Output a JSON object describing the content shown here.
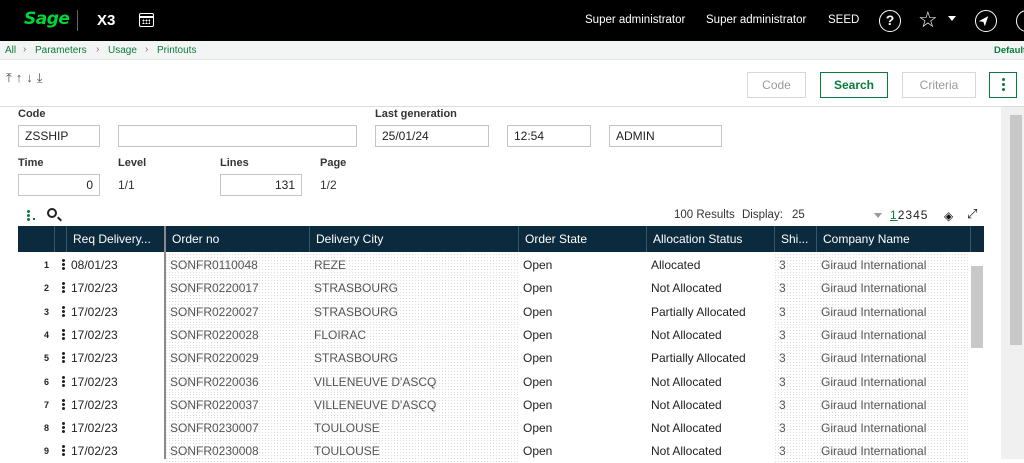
{
  "topbar": {
    "logo": "Sage",
    "app": "X3",
    "user1": "Super administrator",
    "user2": "Super administrator",
    "folder": "SEED",
    "help_icon": "help-icon",
    "favorites_icon": "star-icon",
    "navigate_icon": "compass-icon"
  },
  "breadcrumb": {
    "items": [
      "All",
      "Parameters",
      "Usage",
      "Printouts"
    ],
    "default_label": "Default"
  },
  "actions": {
    "code": "Code",
    "search": "Search",
    "criteria": "Criteria"
  },
  "form": {
    "code_label": "Code",
    "code_value": "ZSSHIP",
    "description_value": "",
    "last_gen_label": "Last generation",
    "last_gen_date": "25/01/24",
    "last_gen_time": "12:54",
    "last_gen_user": "ADMIN",
    "time_label": "Time",
    "time_value": "0",
    "level_label": "Level",
    "level_value": "1/1",
    "lines_label": "Lines",
    "lines_value": "131",
    "page_label": "Page",
    "page_value": "1/2"
  },
  "grid": {
    "results": "100 Results",
    "display_label": "Display:",
    "display_value": "25",
    "pages": [
      "1",
      "2",
      "3",
      "4",
      "5"
    ],
    "columns": [
      "Req Delivery...",
      "Order no",
      "Delivery City",
      "Order State",
      "Allocation Status",
      "Shi...",
      "Company Name"
    ],
    "rows": [
      {
        "n": "1",
        "date": "08/01/23",
        "order": "SONFR0110048",
        "city": "REZE",
        "state": "Open",
        "alloc": "Allocated",
        "ship": "3",
        "company": "Giraud International"
      },
      {
        "n": "2",
        "date": "17/02/23",
        "order": "SONFR0220017",
        "city": "STRASBOURG",
        "state": "Open",
        "alloc": "Not Allocated",
        "ship": "3",
        "company": "Giraud International"
      },
      {
        "n": "3",
        "date": "17/02/23",
        "order": "SONFR0220027",
        "city": "STRASBOURG",
        "state": "Open",
        "alloc": "Partially Allocated",
        "ship": "3",
        "company": "Giraud International"
      },
      {
        "n": "4",
        "date": "17/02/23",
        "order": "SONFR0220028",
        "city": "FLOIRAC",
        "state": "Open",
        "alloc": "Not Allocated",
        "ship": "3",
        "company": "Giraud International"
      },
      {
        "n": "5",
        "date": "17/02/23",
        "order": "SONFR0220029",
        "city": "STRASBOURG",
        "state": "Open",
        "alloc": "Partially Allocated",
        "ship": "3",
        "company": "Giraud International"
      },
      {
        "n": "6",
        "date": "17/02/23",
        "order": "SONFR0220036",
        "city": "VILLENEUVE D'ASCQ",
        "state": "Open",
        "alloc": "Not Allocated",
        "ship": "3",
        "company": "Giraud International"
      },
      {
        "n": "7",
        "date": "17/02/23",
        "order": "SONFR0220037",
        "city": "VILLENEUVE D'ASCQ",
        "state": "Open",
        "alloc": "Not Allocated",
        "ship": "3",
        "company": "Giraud International"
      },
      {
        "n": "8",
        "date": "17/02/23",
        "order": "SONFR0230007",
        "city": "TOULOUSE",
        "state": "Open",
        "alloc": "Not Allocated",
        "ship": "3",
        "company": "Giraud International"
      },
      {
        "n": "9",
        "date": "17/02/23",
        "order": "SONFR0230008",
        "city": "TOULOUSE",
        "state": "Open",
        "alloc": "Not Allocated",
        "ship": "3",
        "company": "Giraud International"
      }
    ]
  }
}
